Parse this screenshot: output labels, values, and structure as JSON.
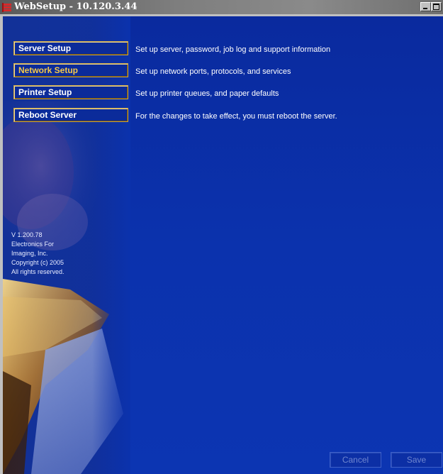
{
  "window": {
    "title": "WebSetup - 10.120.3.44",
    "icon": "app-icon"
  },
  "nav": [
    {
      "label": "Server Setup",
      "description": "Set up server, password, job log and support information",
      "active": false
    },
    {
      "label": "Network Setup",
      "description": "Set up network ports, protocols, and services",
      "active": true
    },
    {
      "label": "Printer Setup",
      "description": "Set up printer queues, and paper defaults",
      "active": false
    },
    {
      "label": "Reboot Server",
      "description": "For the changes to take effect, you must reboot the server.",
      "active": false
    }
  ],
  "version_info": {
    "line1": "V 1.200.78",
    "line2": "Electronics For",
    "line3": "Imaging, Inc.",
    "line4": "Copyright (c) 2005",
    "line5": "All rights reserved."
  },
  "footer": {
    "cancel_label": "Cancel",
    "save_label": "Save"
  },
  "colors": {
    "background": "#0b32ad",
    "accent_gold": "#c9a64a",
    "active_text": "#f4c84a"
  }
}
